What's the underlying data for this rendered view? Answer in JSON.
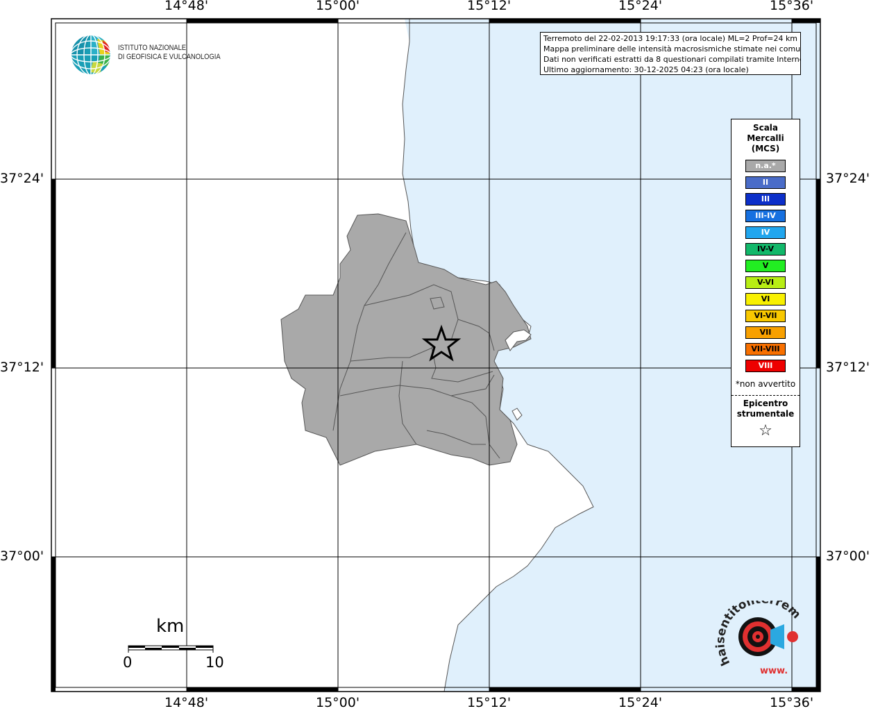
{
  "info_box": {
    "line1": "Terremoto del 22-02-2013 19:17:33 (ora locale) ML=2 Prof=24 km",
    "line2": "Mappa preliminare delle intensità macrosismiche stimate nei comuni",
    "line3": "Dati non verificati estratti da 8 questionari compilati tramite Internet.",
    "line4": "Ultimo aggiornamento: 30-12-2025 04:23 (ora locale)"
  },
  "logo": {
    "line1": "ISTITUTO NAZIONALE",
    "line2": "DI GEOFISICA E VULCANOLOGIA",
    "icon": "ingv-globe-icon"
  },
  "axes": {
    "longitude_ticks": [
      "14°48'",
      "15°00'",
      "15°12'",
      "15°24'",
      "15°36'"
    ],
    "latitude_ticks": [
      "37°24'",
      "37°12'",
      "37°00'"
    ]
  },
  "legend": {
    "title_line1": "Scala",
    "title_line2": "Mercalli",
    "title_line3": "(MCS)",
    "items": [
      {
        "label": "n.a.*",
        "color": "#a9a9a9",
        "text_color": "#ffffff"
      },
      {
        "label": "II",
        "color": "#4a6cc8",
        "text_color": "#ffffff"
      },
      {
        "label": "III",
        "color": "#0c2fc9",
        "text_color": "#ffffff"
      },
      {
        "label": "III-IV",
        "color": "#1670e0",
        "text_color": "#ffffff"
      },
      {
        "label": "IV",
        "color": "#21a6ee",
        "text_color": "#ffffff"
      },
      {
        "label": "IV-V",
        "color": "#12b86a",
        "text_color": "#000000"
      },
      {
        "label": "V",
        "color": "#22ee22",
        "text_color": "#000000"
      },
      {
        "label": "V-VI",
        "color": "#b8ee14",
        "text_color": "#000000"
      },
      {
        "label": "VI",
        "color": "#f8f000",
        "text_color": "#000000"
      },
      {
        "label": "VI-VII",
        "color": "#f8c800",
        "text_color": "#000000"
      },
      {
        "label": "VII",
        "color": "#f8a000",
        "text_color": "#000000"
      },
      {
        "label": "VII-VIII",
        "color": "#f87000",
        "text_color": "#000000"
      },
      {
        "label": "VIII",
        "color": "#ee0000",
        "text_color": "#ffffff"
      }
    ],
    "note": "*non avvertito",
    "epicenter_line1": "Epicentro",
    "epicenter_line2": "strumentale",
    "epicenter_symbol": "☆"
  },
  "scale_bar": {
    "unit": "km",
    "min": "0",
    "max": "10"
  },
  "watermark": {
    "text": "haisentitoilterremoto.it",
    "prefix": "www.",
    "icon": "target-megaphone-icon"
  },
  "colors": {
    "sea": "#e0f0fc",
    "land": "#ffffff",
    "affected": "#a9a9a9"
  }
}
